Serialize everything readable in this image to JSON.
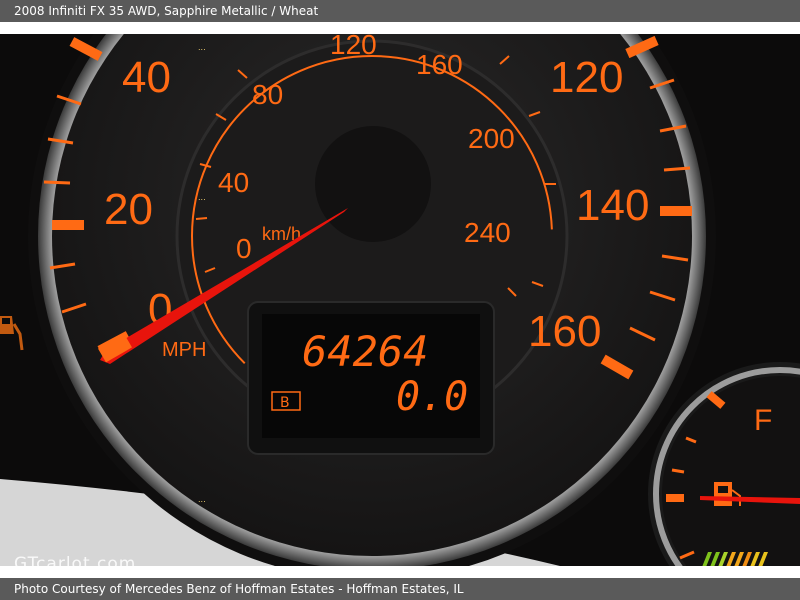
{
  "header": {
    "caption": "2008 Infiniti FX 35 AWD,  Sapphire Metallic / Wheat"
  },
  "footer": {
    "credit": "Photo Courtesy of Mercedes Benz of Hoffman Estates - Hoffman Estates, IL"
  },
  "watermark": {
    "text": "GTcarlot.com"
  },
  "gauge": {
    "mph_labels": [
      "0",
      "20",
      "40",
      "120",
      "140",
      "160"
    ],
    "kmh_labels": [
      "0",
      "40",
      "80",
      "120",
      "160",
      "200",
      "240"
    ],
    "unit_mph": "MPH",
    "unit_kmh": "km/h",
    "odometer": "64264",
    "trip": "0.0",
    "trip_label": "B",
    "fuel_label": "F"
  },
  "colors": {
    "accent": "#ff6a14",
    "needle": "#e8140c",
    "face": "#161515",
    "chrome": "#c8c8c8"
  }
}
